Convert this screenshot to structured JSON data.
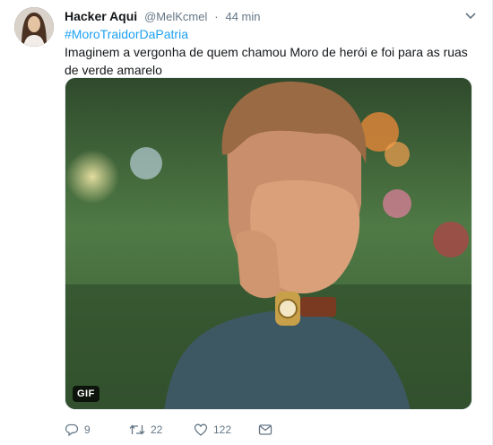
{
  "tweet": {
    "author_name": "Hacker Aqui",
    "handle": "@MelKcmel",
    "separator": "·",
    "time": "44 min",
    "hashtag": "#MoroTraidorDaPatria",
    "text": "Imaginem a vergonha de quem chamou Moro de herói e foi para as ruas de verde amarelo",
    "media_badge": "GIF"
  },
  "actions": {
    "replies": "9",
    "retweets": "22",
    "likes": "122"
  },
  "icons": {
    "caret": "chevron-down-icon",
    "reply": "reply-icon",
    "retweet": "retweet-icon",
    "like": "heart-icon",
    "dm": "direct-message-icon"
  },
  "colors": {
    "link": "#1da1f2",
    "meta": "#657786",
    "text": "#14171a"
  }
}
